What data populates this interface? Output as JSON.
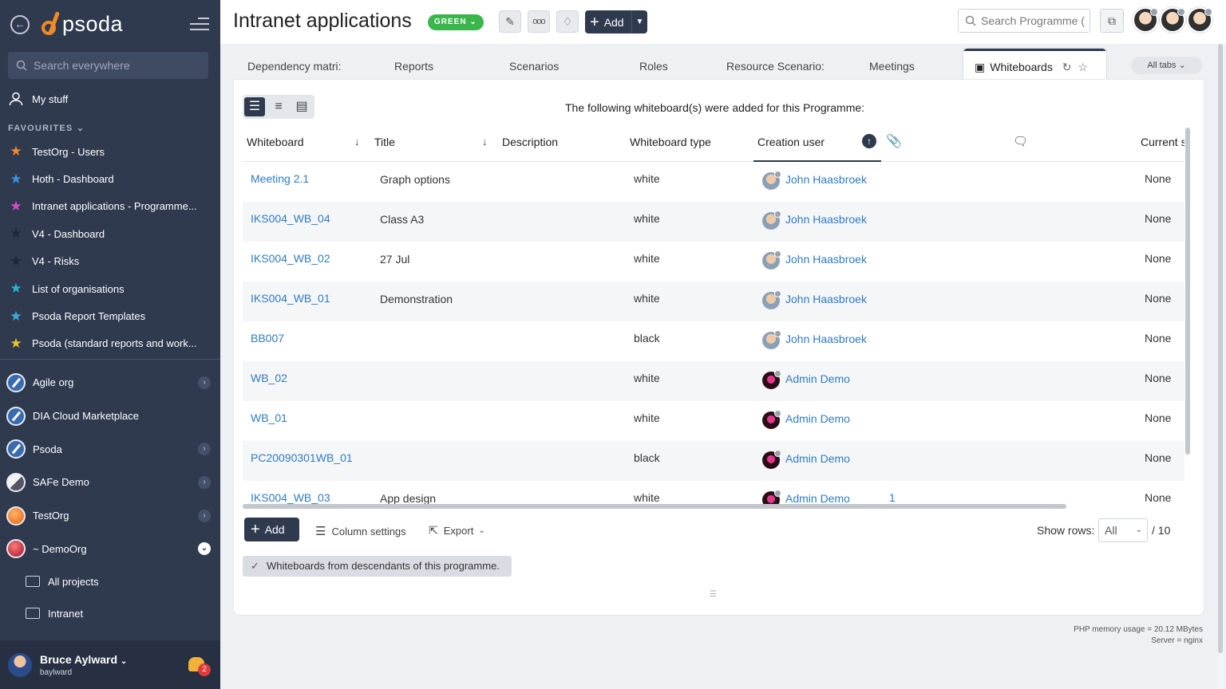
{
  "sidebar": {
    "logo_text": "psoda",
    "search_placeholder": "Search everywhere",
    "my_stuff": "My stuff",
    "favourites_label": "FAVOURITES",
    "favourites": [
      {
        "label": "TestOrg - Users",
        "color": "#f0882c"
      },
      {
        "label": "Hoth - Dashboard",
        "color": "#3d8fe0"
      },
      {
        "label": "Intranet applications - Programme...",
        "color": "#d54cd0"
      },
      {
        "label": "V4 - Dashboard",
        "color": "#1f2533"
      },
      {
        "label": "V4 - Risks",
        "color": "#1f2533"
      },
      {
        "label": "List of organisations",
        "color": "#27b3d6"
      },
      {
        "label": "Psoda Report Templates",
        "color": "#3dadd8"
      },
      {
        "label": "Psoda (standard reports and work...",
        "color": "#f2c028"
      }
    ],
    "orgs": [
      {
        "label": "Agile org",
        "icon": "compass",
        "arrow": "right"
      },
      {
        "label": "DIA Cloud Marketplace",
        "icon": "compass",
        "arrow": ""
      },
      {
        "label": "Psoda",
        "icon": "compass",
        "arrow": "right"
      },
      {
        "label": "SAFe Demo",
        "icon": "safe",
        "arrow": "right"
      },
      {
        "label": "TestOrg",
        "icon": "test",
        "arrow": "right"
      },
      {
        "label": "~ DemoOrg",
        "icon": "demo",
        "arrow": "down"
      }
    ],
    "sub_items": [
      "All projects",
      "Intranet"
    ],
    "user": {
      "name": "Bruce Aylward",
      "login": "baylward",
      "notifications": "2"
    }
  },
  "header": {
    "title": "Intranet applications",
    "status": "GREEN",
    "add_label": "Add",
    "search_placeholder": "Search Programme (",
    "status_color": "#3bb64d"
  },
  "tabs": {
    "items": [
      "Dependency matri:",
      "Reports",
      "Scenarios",
      "Roles",
      "Resource Scenario:",
      "Meetings"
    ],
    "active": "Whiteboards",
    "all_tabs": "All tabs"
  },
  "grid": {
    "intro": "The following whiteboard(s) were added for this Programme:",
    "columns": {
      "whiteboard": "Whiteboard",
      "title": "Title",
      "description": "Description",
      "type": "Whiteboard type",
      "creator": "Creation user",
      "current": "Current s"
    },
    "rows": [
      {
        "whiteboard": "Meeting 2.1",
        "title": "Graph options",
        "type": "white",
        "creator": "John Haasbroek",
        "avatar": "john",
        "attachments": "",
        "current": "None"
      },
      {
        "whiteboard": "IKS004_WB_04",
        "title": "Class A3",
        "type": "white",
        "creator": "John Haasbroek",
        "avatar": "john",
        "attachments": "",
        "current": "None"
      },
      {
        "whiteboard": "IKS004_WB_02",
        "title": "27 Jul",
        "type": "white",
        "creator": "John Haasbroek",
        "avatar": "john",
        "attachments": "",
        "current": "None"
      },
      {
        "whiteboard": "IKS004_WB_01",
        "title": "Demonstration",
        "type": "white",
        "creator": "John Haasbroek",
        "avatar": "john",
        "attachments": "",
        "current": "None"
      },
      {
        "whiteboard": "BB007",
        "title": "",
        "type": "black",
        "creator": "John Haasbroek",
        "avatar": "john",
        "attachments": "",
        "current": "None"
      },
      {
        "whiteboard": "WB_02",
        "title": "",
        "type": "white",
        "creator": "Admin Demo",
        "avatar": "admin",
        "attachments": "",
        "current": "None"
      },
      {
        "whiteboard": "WB_01",
        "title": "",
        "type": "white",
        "creator": "Admin Demo",
        "avatar": "admin",
        "attachments": "",
        "current": "None"
      },
      {
        "whiteboard": "PC20090301WB_01",
        "title": "",
        "type": "black",
        "creator": "Admin Demo",
        "avatar": "admin",
        "attachments": "",
        "current": "None"
      },
      {
        "whiteboard": "IKS004_WB_03",
        "title": "App design",
        "type": "white",
        "creator": "Admin Demo",
        "avatar": "admin",
        "attachments": "1",
        "current": "None"
      }
    ],
    "add_label": "Add",
    "column_settings": "Column settings",
    "export": "Export",
    "show_rows_label": "Show rows:",
    "show_rows_value": "All",
    "rows_total": "/ 10",
    "descendants_chip": "Whiteboards from descendants of this programme."
  },
  "footer": {
    "memory": "PHP memory usage = 20.12 MBytes",
    "server": "Server = nginx"
  }
}
